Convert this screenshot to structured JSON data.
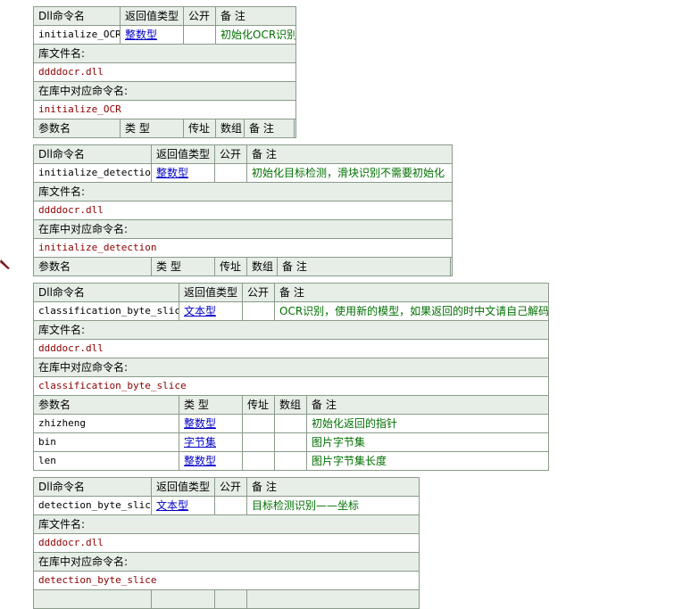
{
  "labels": {
    "dll_cmd": "Dll命令名",
    "return_type": "返回值类型",
    "public": "公开",
    "remark": "备 注",
    "lib_file": "库文件名:",
    "lib_cmd": "在库中对应命令名:",
    "param_name": "参数名",
    "type": "类 型",
    "byref": "传址",
    "array": "数组"
  },
  "commands": [
    {
      "name": "initialize_OCR",
      "return_type": "整数型",
      "public": "",
      "remark": "初始化OCR识别",
      "lib_file": "ddddocr.dll",
      "lib_command": "initialize_OCR",
      "params": []
    },
    {
      "name": "initialize_detection",
      "return_type": "整数型",
      "public": "",
      "remark": "初始化目标检测，滑块识别不需要初始化",
      "lib_file": "ddddocr.dll",
      "lib_command": "initialize_detection",
      "params": []
    },
    {
      "name": "classification_byte_slice",
      "return_type": "文本型",
      "public": "",
      "remark": "OCR识别，使用新的模型，如果返回的时中文请自己解码",
      "lib_file": "ddddocr.dll",
      "lib_command": "classification_byte_slice",
      "params": [
        {
          "name": "zhizheng",
          "type": "整数型",
          "byref": "",
          "array": "",
          "remark": "初始化返回的指针"
        },
        {
          "name": "bin",
          "type": "字节集",
          "byref": "",
          "array": "",
          "remark": "图片字节集"
        },
        {
          "name": "len",
          "type": "整数型",
          "byref": "",
          "array": "",
          "remark": "图片字节集长度"
        }
      ]
    },
    {
      "name": "detection_byte_slice",
      "return_type": "文本型",
      "public": "",
      "remark": "目标检测识别——坐标",
      "lib_file": "ddddocr.dll",
      "lib_command": "detection_byte_slice",
      "params": []
    }
  ],
  "colors": {
    "header_bg": "#e7eee7",
    "border": "#8a9a8a",
    "name_text": "#8b0000",
    "type_link": "#0000c8",
    "remark_text": "#007000"
  },
  "icons": {
    "cursor": "mouse-pointer-icon"
  }
}
